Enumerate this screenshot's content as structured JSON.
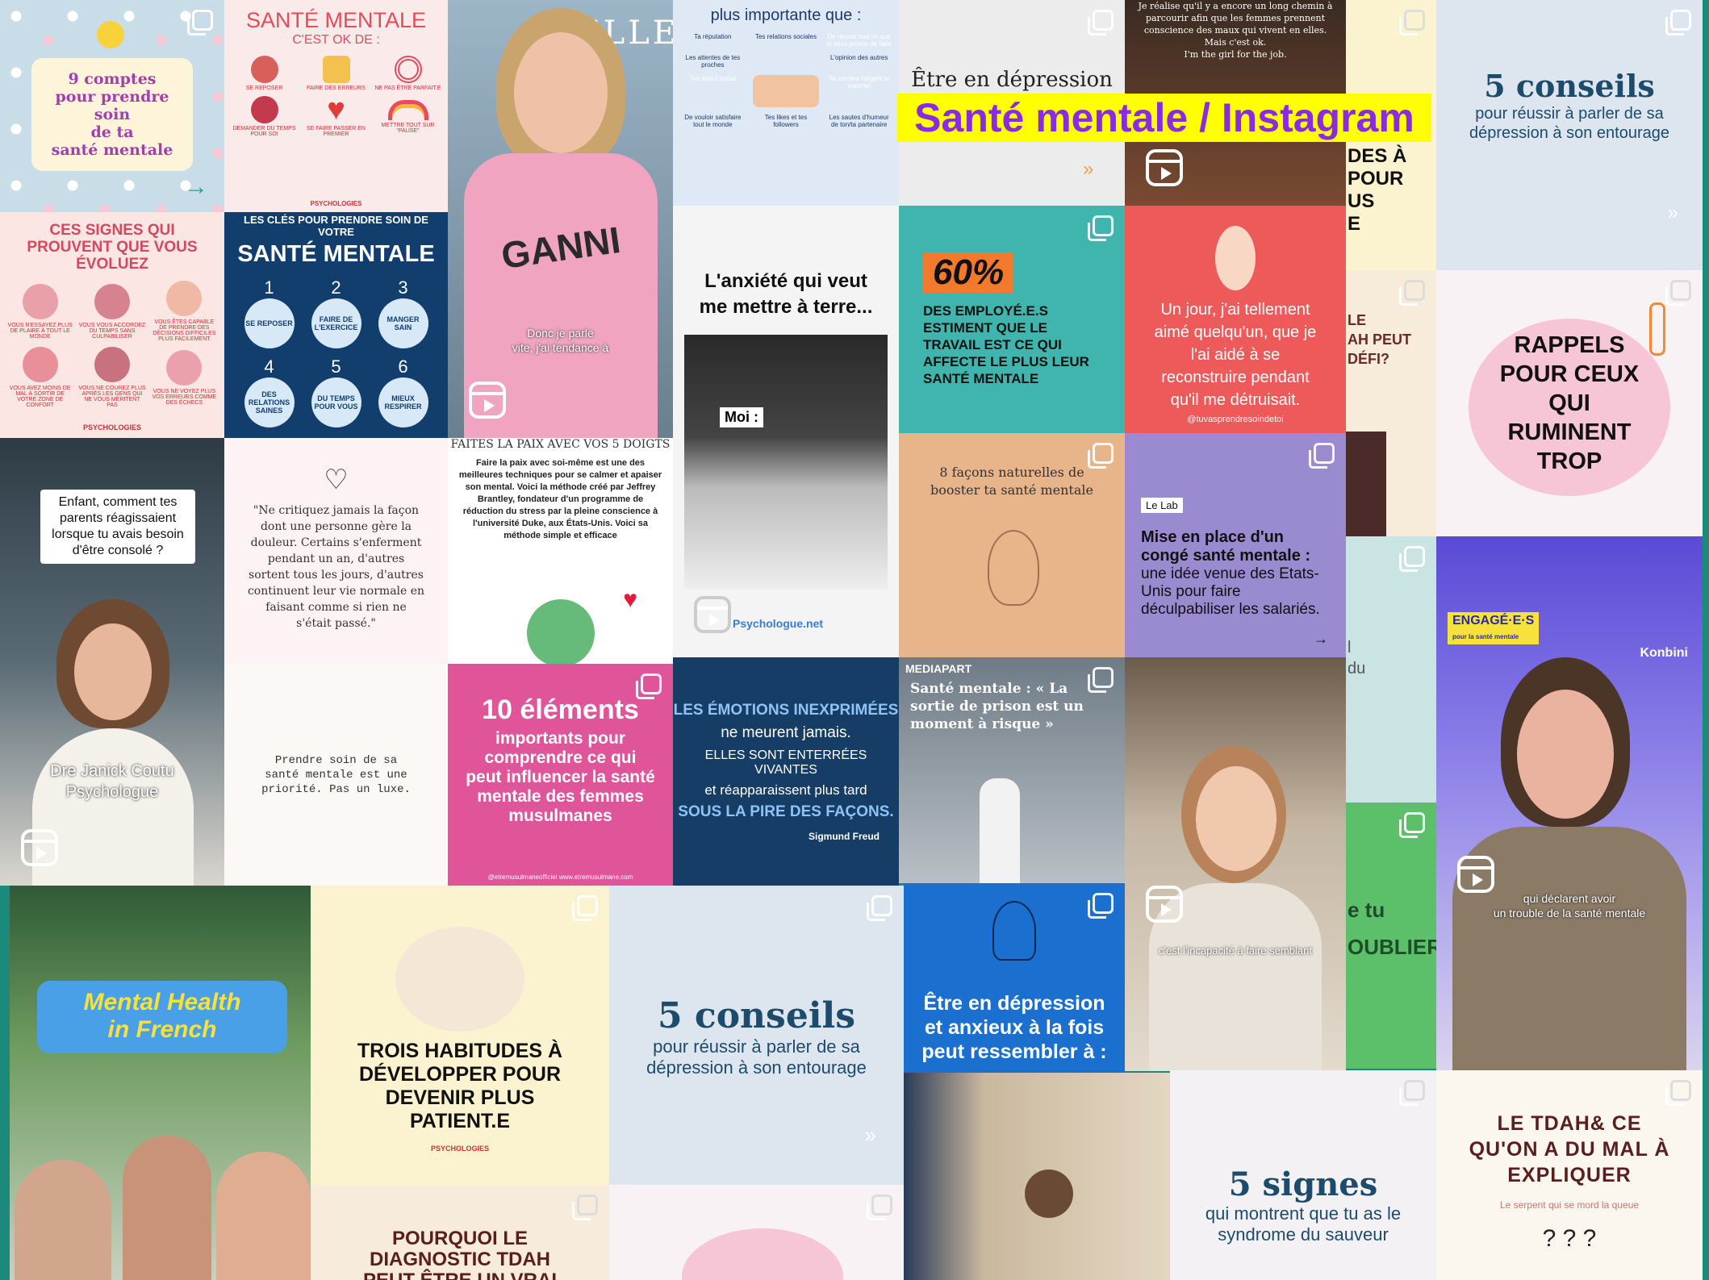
{
  "page_title": "Santé mentale / Instagram",
  "posts": {
    "p1": {
      "text": "9 comptes\npour prendre\nsoin\nde ta\nsanté mentale"
    },
    "p2": {
      "title": "SANTÉ MENTALE",
      "subtitle": "C'EST OK DE :",
      "items": [
        "SE REPOSER",
        "FAIRE DES ERREURS",
        "NE PAS ÊTRE PARFAIT.E",
        "DEMANDER DU TEMPS POUR SOI",
        "SE FAIRE PASSER EN PREMIER",
        "METTRE TOUT SUR \"PAUSE\""
      ],
      "brand": "PSYCHOLOGIES"
    },
    "p3": {
      "logo": "ELLE",
      "shirt": "GANNI",
      "caption": "Donc je parle\nvite, j'ai tendance à"
    },
    "p4": {
      "title": "plus importante que :",
      "items": [
        "Ta réputation",
        "Tes relations sociales",
        "De réussir tout ce que tu vous promis de faire",
        "Les attentes de tes proches",
        "L'opinion des autres",
        "Ton statut social",
        "Ta carrière l'argent le matériel",
        "De vouloir satisfaire tout le monde",
        "Tes likes et tes followers",
        "Les sautes d'humeur de ton/ta partenaire"
      ]
    },
    "p5": {
      "title": "Être en dépression"
    },
    "p6": {
      "text": "Je réalise qu'il y a encore un long chemin à parcourir afin que les femmes prennent conscience des maux qui vivent en elles.\nMais c'est ok.\nI'm the girl for the job."
    },
    "p7": {
      "title": "5 conseils",
      "subtitle": "pour réussir à parler de sa dépression à son entourage"
    },
    "p8": {
      "title": "CES SIGNES QUI PROUVENT QUE VOUS ÉVOLUEZ",
      "items": [
        "VOUS N'ESSAYEZ PLUS DE PLAIRE À TOUT LE MONDE",
        "VOUS VOUS ACCORDEZ DU TEMPS SANS CULPABILISER",
        "VOUS ÊTES CAPABLE DE PRENDRE DES DÉCISIONS DIFFICILES PLUS FACILEMENT",
        "VOUS AVEZ MOINS DE MAL À SORTIR DE VOTRE ZONE DE CONFORT",
        "VOUS NE COUREZ PLUS APRÈS LES GENS QUI NE VOUS MÉRITENT PAS",
        "VOUS NE VOYEZ PLUS VOS ERREURS COMME DES ÉCHECS"
      ],
      "brand": "PSYCHOLOGIES"
    },
    "p9": {
      "header": "LES CLÉS POUR PRENDRE SOIN DE VOTRE",
      "title": "SANTÉ MENTALE",
      "items": [
        {
          "n": "1",
          "t": "SE REPOSER"
        },
        {
          "n": "2",
          "t": "FAIRE DE L'EXERCICE"
        },
        {
          "n": "3",
          "t": "MANGER SAIN"
        },
        {
          "n": "4",
          "t": "DES RELATIONS SAINES"
        },
        {
          "n": "5",
          "t": "DU TEMPS POUR VOUS"
        },
        {
          "n": "6",
          "t": "MIEUX RESPIRER"
        }
      ]
    },
    "p10": {
      "title": "L'anxiété qui veut\nme mettre à terre...",
      "label": "Moi :",
      "brand": "Psychologue.net"
    },
    "p11": {
      "big": "60%",
      "text": "DES EMPLOYÉ.E.S ESTIMENT QUE LE TRAVAIL EST CE QUI AFFECTE LE PLUS LEUR SANTÉ MENTALE"
    },
    "p12": {
      "text": "Un jour, j'ai tellement aimé quelqu'un, que je l'ai aidé à se reconstruire pendant qu'il me détruisait.",
      "handle": "@tuvasprendresoindetoi"
    },
    "p13": {
      "partial": "DES À\nPOUR\nUS\nE"
    },
    "p14": {
      "partial": "LE\nAH PEUT\nDÉFI?"
    },
    "p15": {
      "text": "RAPPELS POUR CEUX QUI RUMINENT TROP"
    },
    "p16": {
      "text": "Enfant, comment tes parents réagissaient lorsque tu avais besoin d'être consolé ?",
      "name": "Dre Janick Coutu\nPsychologue"
    },
    "p17": {
      "text": "\"Ne critiquez jamais la façon dont une personne gère la douleur. Certains s'enferment pendant un an, d'autres sortent tous les jours, d'autres continuent leur vie normale en faisant comme si rien ne s'était passé.\""
    },
    "p18": {
      "title": "FAITES LA PAIX AVEC VOS 5 DOIGTS",
      "text": "Faire la paix avec soi-même est une des meilleures techniques pour se calmer et apaiser son mental. Voici la méthode créé par Jeffrey Brantley, fondateur d'un programme de réduction du stress par la pleine conscience à l'université Duke, aux États-Unis. Voici sa méthode simple et efficace"
    },
    "p19": {
      "title": "8 façons naturelles de booster ta santé mentale"
    },
    "p20": {
      "tag": "Le Lab",
      "bold": "Mise en place d'un congé santé mentale :",
      "text": "une idée venue des Etats-Unis pour faire déculpabiliser les salariés."
    },
    "p21": {
      "text": "Prendre soin de sa santé mentale est une priorité. Pas un luxe."
    },
    "p22": {
      "title": "10 éléments",
      "text": "importants pour comprendre ce qui peut influencer la santé mentale des femmes musulmanes",
      "handle": "@etremusulmaneofficiel   www.etremusulmane.com"
    },
    "p23": {
      "l1": "LES ÉMOTIONS INEXPRIMÉES",
      "l2": "ne meurent jamais.",
      "l3": "ELLES SONT ENTERRÉES VIVANTES",
      "l4": "et réapparaissent plus tard",
      "l5": "SOUS LA PIRE DES FAÇONS.",
      "author": "Sigmund Freud"
    },
    "p24": {
      "brand": "MEDIAPART",
      "title": "Santé mentale : « La sortie de prison est un moment à risque »"
    },
    "p25": {
      "caption": "c'est l'incapacité à faire semblant"
    },
    "p26": {
      "partial": "l\ndu"
    },
    "p27": {
      "partial": "e tu\nOUBLIER"
    },
    "p28": {
      "badge": "ENGAGÉ·E·S",
      "badge_sub": "pour la santé mentale",
      "brand": "Konbini",
      "caption": "qui déclarent avoir\nun trouble de la santé mentale"
    },
    "p29": {
      "title": "Mental Health",
      "title2": "in French"
    },
    "p30": {
      "text": "TROIS HABITUDES À DÉVELOPPER POUR DEVENIR PLUS PATIENT.E",
      "brand": "PSYCHOLOGIES"
    },
    "p31": {
      "title": "5 conseils",
      "subtitle": "pour réussir à parler de sa dépression à son entourage"
    },
    "p32": {
      "text": "Être en dépression et anxieux à la fois peut ressembler à :"
    },
    "p33": {
      "text": "POURQUOI LE DIAGNOSTIC TDAH PEUT ÊTRE UN VRAI DÉFI?"
    },
    "p34": {
      "title": "5 signes",
      "subtitle": "qui montrent que tu as le syndrome du sauveur"
    },
    "p35": {
      "title": "LE TDAH& CE QU'ON A DU MAL À EXPLIQUER",
      "subtitle": "Le serpent qui se mord la queue",
      "marks": "? ? ?"
    }
  },
  "colors": {
    "title_bg": "#ffff00",
    "title_text": "#8a2be2",
    "frame": "#1b8a7a"
  }
}
